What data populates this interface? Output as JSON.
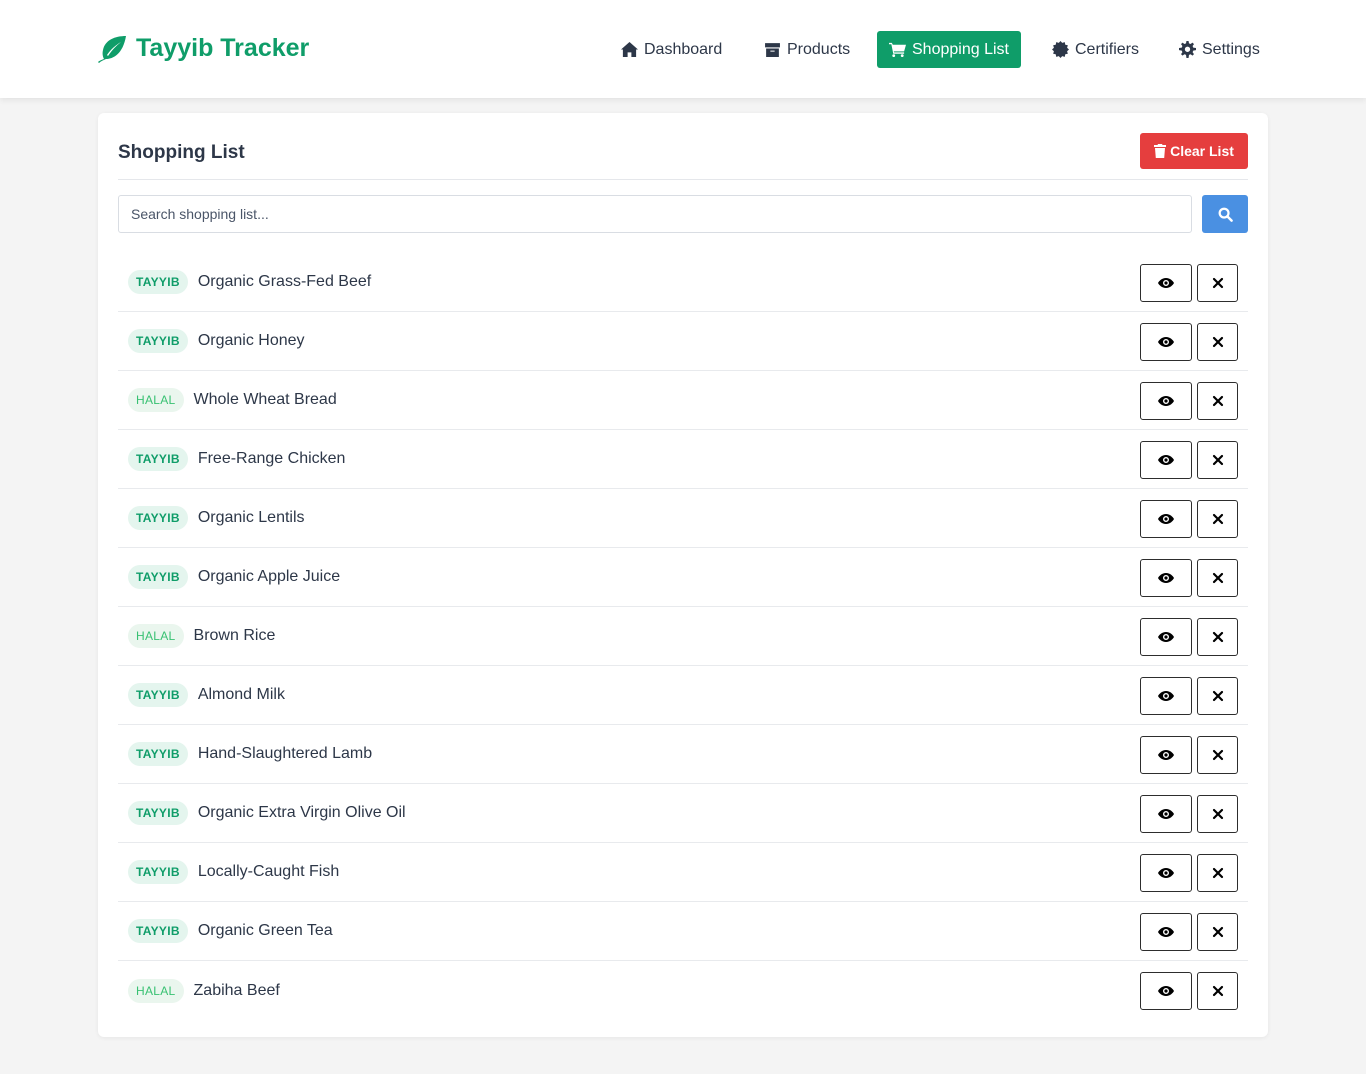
{
  "brand": {
    "name": "Tayyib Tracker",
    "color": "#0f9d69",
    "icon": "leaf-icon"
  },
  "nav": [
    {
      "label": "Dashboard",
      "icon": "home-icon",
      "active": false
    },
    {
      "label": "Products",
      "icon": "box-icon",
      "active": false
    },
    {
      "label": "Shopping List",
      "icon": "cart-icon",
      "active": true
    },
    {
      "label": "Certifiers",
      "icon": "certificate-icon",
      "active": false
    },
    {
      "label": "Settings",
      "icon": "gear-icon",
      "active": false
    }
  ],
  "page": {
    "title": "Shopping List",
    "clear_label": "Clear List",
    "search_placeholder": "Search shopping list..."
  },
  "items": [
    {
      "badge": "TAYYIB",
      "name": "Organic Grass-Fed Beef"
    },
    {
      "badge": "TAYYIB",
      "name": "Organic Honey"
    },
    {
      "badge": "HALAL",
      "name": "Whole Wheat Bread"
    },
    {
      "badge": "TAYYIB",
      "name": "Free-Range Chicken"
    },
    {
      "badge": "TAYYIB",
      "name": "Organic Lentils"
    },
    {
      "badge": "TAYYIB",
      "name": "Organic Apple Juice"
    },
    {
      "badge": "HALAL",
      "name": "Brown Rice"
    },
    {
      "badge": "TAYYIB",
      "name": "Almond Milk"
    },
    {
      "badge": "TAYYIB",
      "name": "Hand-Slaughtered Lamb"
    },
    {
      "badge": "TAYYIB",
      "name": "Organic Extra Virgin Olive Oil"
    },
    {
      "badge": "TAYYIB",
      "name": "Locally-Caught Fish"
    },
    {
      "badge": "TAYYIB",
      "name": "Organic Green Tea"
    },
    {
      "badge": "HALAL",
      "name": "Zabiha Beef"
    }
  ],
  "colors": {
    "accent": "#0f9d69",
    "danger": "#e53e3e",
    "primary": "#4a90e2"
  }
}
